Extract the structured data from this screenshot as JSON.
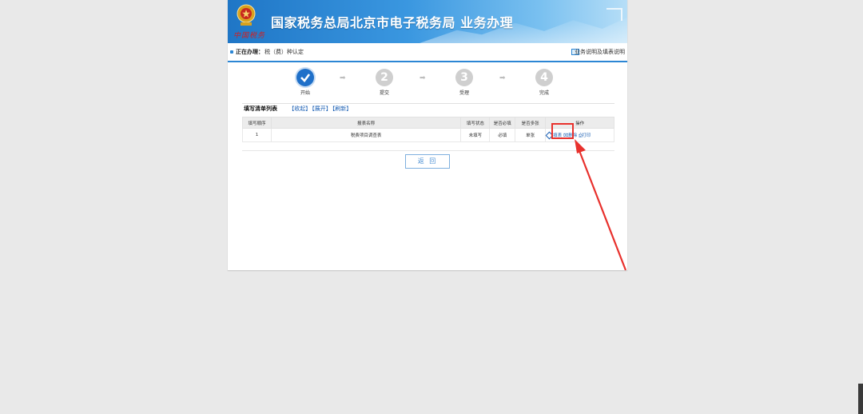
{
  "banner": {
    "title": "国家税务总局北京市电子税务局  业务办理",
    "logo_text": "中国税务"
  },
  "taskbar": {
    "label": "正在办理：",
    "value": "税（费）种认定",
    "help_link": "业务说明及填表说明"
  },
  "steps": [
    {
      "number": "",
      "label": "开始",
      "state": "done"
    },
    {
      "number": "2",
      "label": "提交",
      "state": "pending"
    },
    {
      "number": "3",
      "label": "受理",
      "state": "pending"
    },
    {
      "number": "4",
      "label": "完成",
      "state": "pending"
    }
  ],
  "list": {
    "title": "填写清单列表",
    "collapse_link": "【收起】",
    "expand_link": "【展开】",
    "refresh_link": "【刷新】",
    "columns": [
      "填写顺序",
      "报表名称",
      "填写状态",
      "是否必填",
      "是否多张",
      "操作"
    ],
    "rows": [
      {
        "order": "1",
        "name": "税费项目调查表",
        "status": "未填写",
        "required": "必填",
        "multi": "单张",
        "fill_action": "填表",
        "delete_action": "删除",
        "print_action": "打印"
      }
    ]
  },
  "back_button": "返 回",
  "colors": {
    "primary": "#1f70c9",
    "annotation": "#e8312d",
    "link": "#1a5fb4"
  }
}
